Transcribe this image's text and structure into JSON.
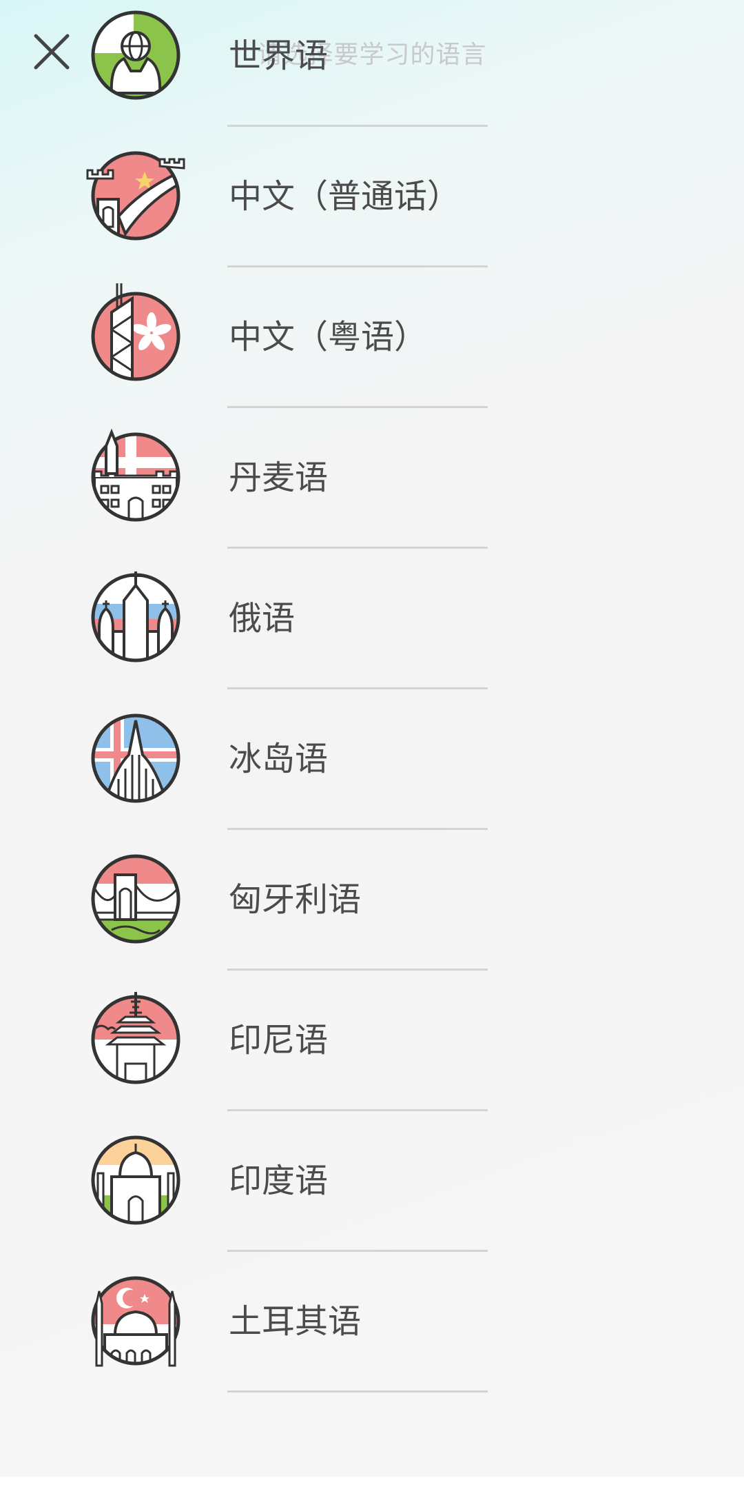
{
  "header": {
    "title": "请选择要学习的语言",
    "close_icon": "close-icon"
  },
  "languages": [
    {
      "label": "世界语",
      "icon": "esperanto-hands-globe-icon",
      "colors": [
        "#8cc34a",
        "#ffffff"
      ]
    },
    {
      "label": "中文（普通话）",
      "icon": "great-wall-icon",
      "colors": [
        "#f08a8a",
        "#f6d36a"
      ]
    },
    {
      "label": "中文（粤语）",
      "icon": "hong-kong-tower-icon",
      "colors": [
        "#f08a8a",
        "#ffffff"
      ]
    },
    {
      "label": "丹麦语",
      "icon": "danish-castle-icon",
      "colors": [
        "#f08a8a",
        "#ffffff"
      ]
    },
    {
      "label": "俄语",
      "icon": "st-basil-cathedral-icon",
      "colors": [
        "#8ec0ea",
        "#f08a8a"
      ]
    },
    {
      "label": "冰岛语",
      "icon": "hallgrimskirkja-icon",
      "colors": [
        "#8ec0ea",
        "#f08a8a"
      ]
    },
    {
      "label": "匈牙利语",
      "icon": "chain-bridge-icon",
      "colors": [
        "#f08a8a",
        "#8cc34a"
      ]
    },
    {
      "label": "印尼语",
      "icon": "pagoda-temple-icon",
      "colors": [
        "#f08a8a",
        "#ffffff"
      ]
    },
    {
      "label": "印度语",
      "icon": "taj-mahal-icon",
      "colors": [
        "#fcd19a",
        "#8cc34a"
      ]
    },
    {
      "label": "土耳其语",
      "icon": "blue-mosque-icon",
      "colors": [
        "#f08a8a",
        "#ffffff"
      ]
    }
  ]
}
